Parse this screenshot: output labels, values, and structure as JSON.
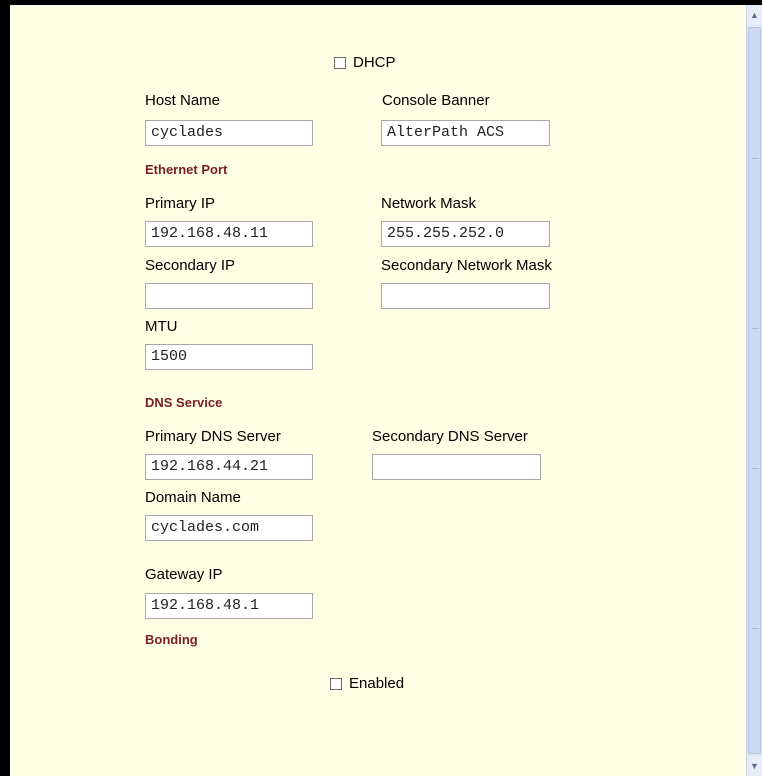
{
  "dhcp": {
    "label": "DHCP",
    "checked": false
  },
  "host_name": {
    "label": "Host Name",
    "value": "cyclades"
  },
  "console_banner": {
    "label": "Console Banner",
    "value": "AlterPath ACS"
  },
  "ethernet_port": {
    "title": "Ethernet Port",
    "primary_ip": {
      "label": "Primary IP",
      "value": "192.168.48.11"
    },
    "network_mask": {
      "label": "Network Mask",
      "value": "255.255.252.0"
    },
    "secondary_ip": {
      "label": "Secondary IP",
      "value": ""
    },
    "secondary_network_mask": {
      "label": "Secondary Network Mask",
      "value": ""
    },
    "mtu": {
      "label": "MTU",
      "value": "1500"
    }
  },
  "dns_service": {
    "title": "DNS Service",
    "primary_dns": {
      "label": "Primary DNS Server",
      "value": "192.168.44.21"
    },
    "secondary_dns": {
      "label": "Secondary DNS Server",
      "value": ""
    },
    "domain_name": {
      "label": "Domain Name",
      "value": "cyclades.com"
    }
  },
  "gateway_ip": {
    "label": "Gateway IP",
    "value": "192.168.48.1"
  },
  "bonding": {
    "title": "Bonding",
    "enabled": {
      "label": "Enabled",
      "checked": false
    }
  },
  "colors": {
    "background": "#ffffe6",
    "section_title": "#7a1e1e",
    "scrollbar": "#dfe7f5"
  }
}
